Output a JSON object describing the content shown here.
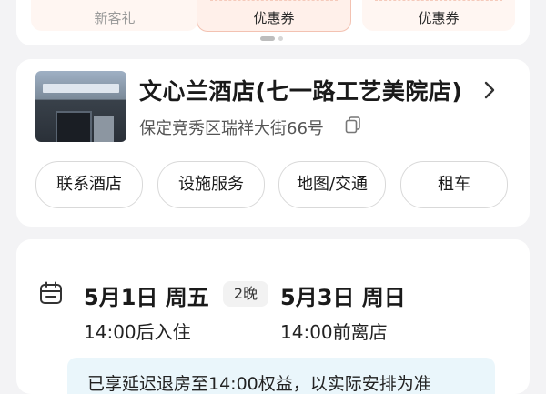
{
  "promo": {
    "tiles": [
      {
        "label": "新客礼"
      },
      {
        "label": "优惠券"
      },
      {
        "label": "优惠券"
      }
    ]
  },
  "hotel": {
    "name": "文心兰酒店(七一路工艺美院店)",
    "address": "保定竞秀区瑞祥大街66号",
    "actions": [
      "联系酒店",
      "设施服务",
      "地图/交通",
      "租车"
    ]
  },
  "stay": {
    "checkin_date": "5月1日 周五",
    "nights": "2晚",
    "checkout_date": "5月3日 周日",
    "checkin_time": "14:00后入住",
    "checkout_time": "14:00前离店",
    "notice": "已享延迟退房至14:00权益，以实际安排为准"
  },
  "icons": {
    "hotel_chevron": "chevron-right-icon",
    "copy": "copy-icon",
    "calendar": "calendar-icon"
  }
}
